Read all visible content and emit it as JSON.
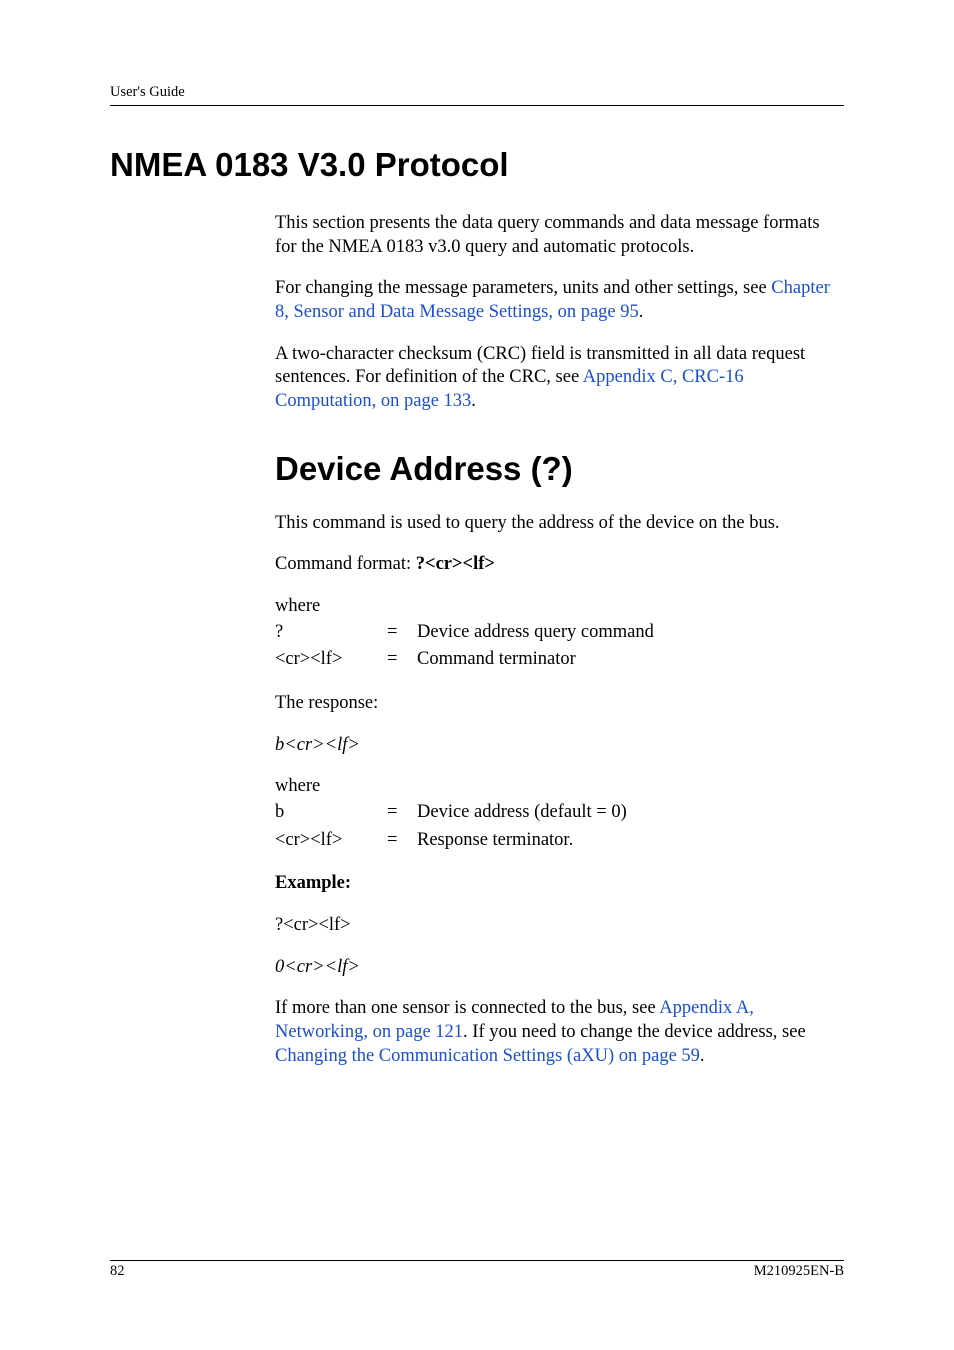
{
  "header": {
    "running": "User's Guide"
  },
  "h1": "NMEA 0183 V3.0 Protocol",
  "intro": {
    "p1": "This section presents the data query commands and data message formats for the NMEA 0183 v3.0 query and automatic protocols.",
    "p2_lead": "For changing the message parameters, units and other settings, see ",
    "p2_link": "Chapter 8, Sensor and Data Message Settings, on page 95",
    "p2_tail": ".",
    "p3_lead": "A two-character checksum (CRC) field is transmitted in all data request sentences. For definition of the CRC, see ",
    "p3_link": "Appendix C, CRC-16 Computation, on page 133",
    "p3_tail": "."
  },
  "h2": "Device Address (?)",
  "device": {
    "p1": "This command is used to query the address of the device on the bus.",
    "cmd_lead": "Command format: ",
    "cmd_bold": "?<cr><lf>",
    "where": "where",
    "row1": {
      "k": " ?",
      "eq": "=",
      "v": "Device address query command"
    },
    "row2": {
      "k": "<cr><lf>",
      "eq": "=",
      "v": "Command terminator"
    },
    "resp_label": "The response:",
    "resp_line": "b<cr><lf>",
    "row3": {
      "k": "b",
      "eq": "=",
      "v": "Device address (default = 0)"
    },
    "row4": {
      "k": "<cr><lf>",
      "eq": "=",
      "v": "Response terminator."
    },
    "example_label": "Example:",
    "example_in": "?<cr><lf>",
    "example_out": "0<cr><lf>",
    "p_last_a": "If more than one sensor is connected to the bus, see ",
    "p_last_link1": "Appendix A, Networking, on page 121",
    "p_last_b": ". If you need to change the device address, see ",
    "p_last_link2": "Changing the Communication Settings (aXU) on page 59",
    "p_last_c": "."
  },
  "footer": {
    "page": "82",
    "docid": "M210925EN-B"
  }
}
